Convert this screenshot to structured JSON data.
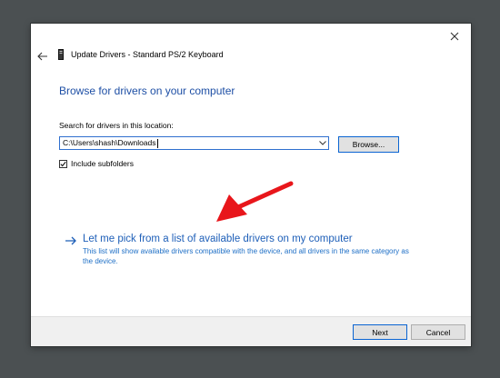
{
  "dialog": {
    "title": "Update Drivers - Standard PS/2 Keyboard",
    "heading": "Browse for drivers on your computer",
    "search_label": "Search for drivers in this location:",
    "path_value": "C:\\Users\\shash\\Downloads",
    "browse_label": "Browse...",
    "include_subfolders_label": "Include subfolders",
    "include_subfolders_checked": true,
    "pick_link_title": "Let me pick from a list of available drivers on my computer",
    "pick_link_desc": "This list will show available drivers compatible with the device, and all drivers in the same category as the device.",
    "next_label": "Next",
    "cancel_label": "Cancel"
  },
  "icons": {
    "close": "close-icon",
    "back": "back-arrow-icon",
    "device": "keyboard-device-icon",
    "dropdown": "chevron-down-icon",
    "checkmark": "checkmark-icon",
    "link_arrow": "right-arrow-icon",
    "annotation": "red-annotation-arrow"
  },
  "colors": {
    "heading_blue": "#1e4fa5",
    "link_blue": "#1e5fb8",
    "focus_border": "#0a64d2",
    "annotation_red": "#e8161b",
    "backdrop": "#4b5052"
  }
}
